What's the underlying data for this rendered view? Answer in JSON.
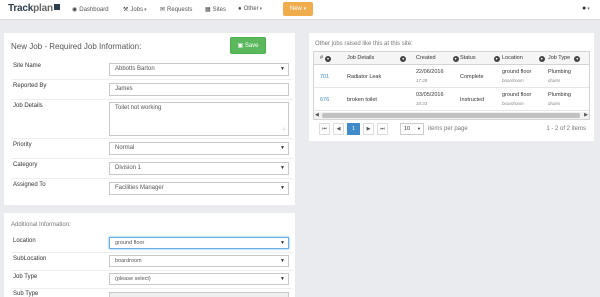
{
  "brand": {
    "name_a": "Track",
    "name_b": "plan"
  },
  "nav": {
    "items": [
      {
        "label": "Dashboard",
        "icon": "dashboard-icon"
      },
      {
        "label": "Jobs",
        "icon": "wrench-icon"
      },
      {
        "label": "Requests",
        "icon": "bullhorn-icon"
      },
      {
        "label": "Sites",
        "icon": "building-icon"
      },
      {
        "label": "Other",
        "icon": "circle-icon"
      }
    ],
    "new_label": "New",
    "user_icon": "user-icon"
  },
  "job_form": {
    "title": "New Job - Required Job Information:",
    "save_label": "Save",
    "fields": [
      {
        "label": "Site Name",
        "value": "Abbotts Barton"
      },
      {
        "label": "Reported By",
        "value": "James"
      },
      {
        "label": "Job Details",
        "value": "Toilet not working"
      },
      {
        "label": "Priority",
        "value": "Normal"
      },
      {
        "label": "Category",
        "value": "Division 1"
      },
      {
        "label": "Assigned To",
        "value": "Facilities Manager"
      }
    ]
  },
  "additional": {
    "title": "Additional Information:",
    "fields": [
      {
        "label": "Location",
        "value": "ground floor"
      },
      {
        "label": "SubLocation",
        "value": "boardroom"
      },
      {
        "label": "Job Type",
        "value": "(please select)"
      },
      {
        "label": "Sub Type",
        "value": ""
      }
    ]
  },
  "other_jobs": {
    "title": "Other jobs raised like this at this site:",
    "columns": [
      "#",
      "Job Details",
      "Created",
      "Status",
      "Location",
      "Job Type"
    ],
    "rows": [
      {
        "id": "701",
        "details": "Radiator Leak",
        "created_date": "22/06/2016",
        "created_time": "17:28",
        "status": "Complete",
        "location": "ground floor",
        "sublocation": "boardroom",
        "job_type": "Plumbing",
        "sub_type": "drains"
      },
      {
        "id": "676",
        "details": "broken toilet",
        "created_date": "03/05/2016",
        "created_time": "10:33",
        "status": "Instructed",
        "location": "ground floor",
        "sublocation": "boardroom",
        "job_type": "Plumbing",
        "sub_type": "drains"
      }
    ],
    "pager": {
      "current_page": "1",
      "per_page": "10",
      "per_page_label": "items per page",
      "info": "1 - 2 of 2 items"
    }
  }
}
